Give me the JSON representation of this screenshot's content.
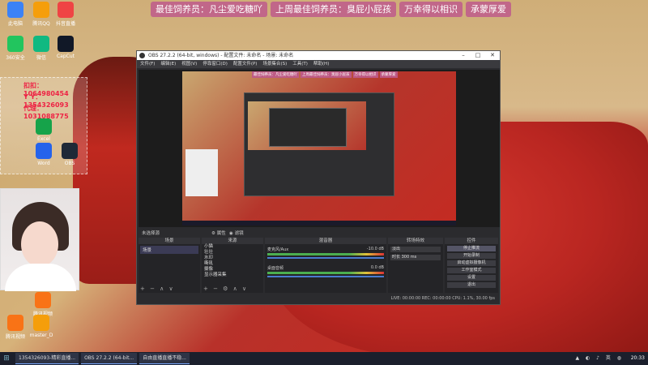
{
  "banner": {
    "tags": [
      "最佳饲养员：凡尘爱吃糖吖",
      "上周最佳饲养员：臭屁小屁孩",
      "万幸得以相识",
      "承蒙厚爱"
    ]
  },
  "desktop": {
    "icons": [
      {
        "label": "此电脑",
        "color": "#3b82f6"
      },
      {
        "label": "腾讯QQ",
        "color": "#f59e0b"
      },
      {
        "label": "抖音直播",
        "color": "#ef4444"
      },
      {
        "label": "360安全",
        "color": "#22c55e"
      },
      {
        "label": "微信",
        "color": "#10b981"
      },
      {
        "label": "CapCut",
        "color": "#111827"
      },
      {
        "label": "Excel",
        "color": "#16a34a"
      },
      {
        "label": "Word",
        "color": "#2563eb"
      },
      {
        "label": "OBS",
        "color": "#1f2937"
      },
      {
        "label": "腾讯视频",
        "color": "#f97316"
      },
      {
        "label": "master_D",
        "color": "#f59e0b"
      }
    ],
    "qq_lines": [
      "扣扣：1064980454",
      "Y Y：1354326093",
      "代理：1031088775"
    ]
  },
  "obs": {
    "title": "OBS 27.2.2 (64-bit, windows) - 配置文件: 未命名 - 场景: 未命名",
    "menu": [
      "文件(F)",
      "编辑(E)",
      "视图(V)",
      "停靠窗口(D)",
      "配置文件(P)",
      "场景集合(S)",
      "工具(T)",
      "帮助(H)"
    ],
    "preview_banner": [
      "最佳饲养员：凡尘爱吃糖吖",
      "上周最佳饲养员：臭屁小屁孩",
      "万幸得以相识",
      "承蒙厚爱"
    ],
    "no_source": "未选择源",
    "properties_label": "属性",
    "filters_label": "滤镜",
    "docks": {
      "scenes_title": "场景",
      "scene_items": [
        "场景"
      ],
      "sources_title": "来源",
      "source_items": [
        "小猫",
        "壮壮",
        "水印",
        "嘶吼",
        "摄像",
        "显示器采集"
      ],
      "mixer_title": "混音器",
      "mixer_rows": [
        {
          "name": "麦克风/Aux",
          "db": "-10.0 dB"
        },
        {
          "name": "桌面音频",
          "db": "0.0 dB"
        }
      ],
      "transitions_title": "转场特效",
      "transition_value": "淡出",
      "duration_label": "时长",
      "duration_value": "300 ms",
      "controls_title": "控件",
      "control_buttons": [
        "停止推流",
        "开始录制",
        "启动虚拟摄像机",
        "工作室模式",
        "设置",
        "退出"
      ]
    },
    "status": "LIVE: 00:00:00   REC: 00:00:00   CPU: 1.1%, 30.00 fps"
  },
  "taskbar": {
    "items": [
      "1354326093-精彩直播...",
      "OBS 27.2.2 (64-bit...",
      "自由直播直播不稳..."
    ],
    "clock": "20:33"
  }
}
